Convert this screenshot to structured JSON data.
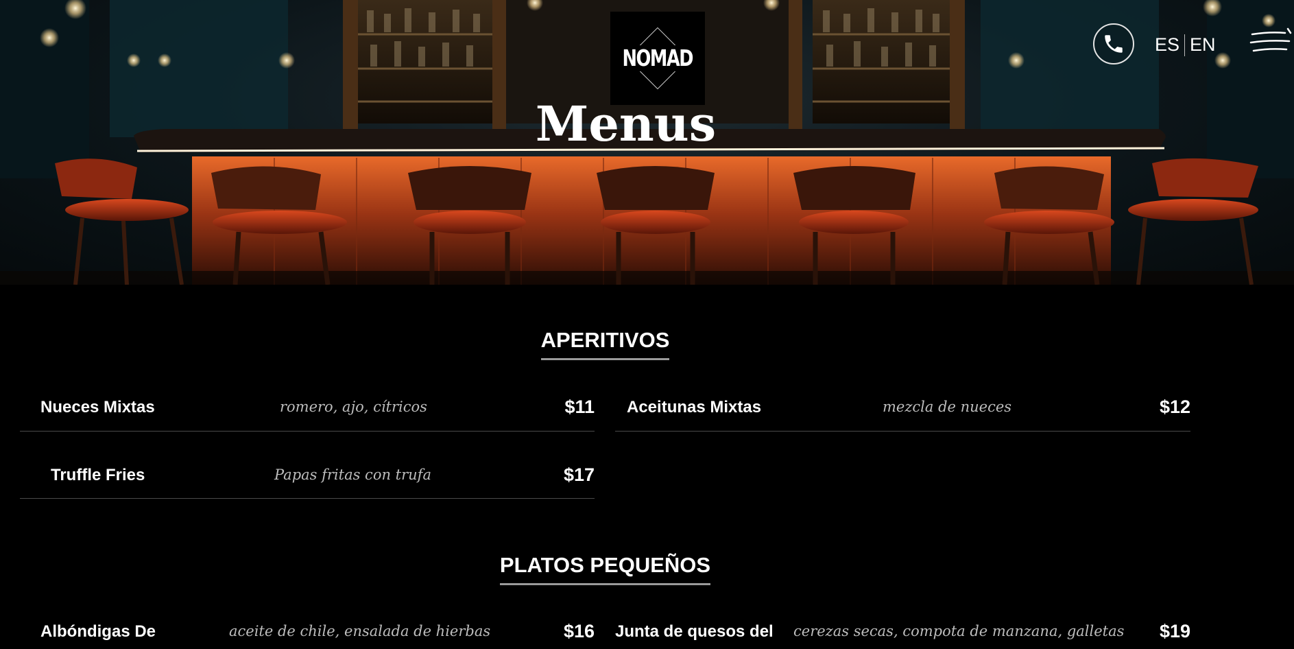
{
  "brand": {
    "logo_text": "NOMAD"
  },
  "hero": {
    "title": "Menus"
  },
  "header": {
    "phone_icon": "phone-icon",
    "languages": [
      "ES",
      "EN"
    ],
    "menu_icon": "hamburger-menu-icon"
  },
  "sections": [
    {
      "title": "APERITIVOS",
      "items": [
        {
          "name": "Nueces Mixtas",
          "desc": "romero, ajo, cítricos",
          "price": "$11"
        },
        {
          "name": "Aceitunas Mixtas",
          "desc": "mezcla de nueces",
          "price": "$12"
        },
        {
          "name": "Truffle Fries",
          "desc": "Papas fritas con trufa",
          "price": "$17"
        }
      ]
    },
    {
      "title": "PLATOS PEQUEÑOS",
      "items": [
        {
          "name": "Albóndigas De",
          "desc": "aceite de chile, ensalada de hierbas",
          "price": "$16"
        },
        {
          "name": "Junta de quesos del",
          "desc": "cerezas secas, compota de manzana, galletas",
          "price": "$19"
        }
      ]
    }
  ],
  "colors": {
    "background": "#000000",
    "text": "#ffffff",
    "muted": "#bdbdbd",
    "bar_glow": "#c4451a"
  }
}
